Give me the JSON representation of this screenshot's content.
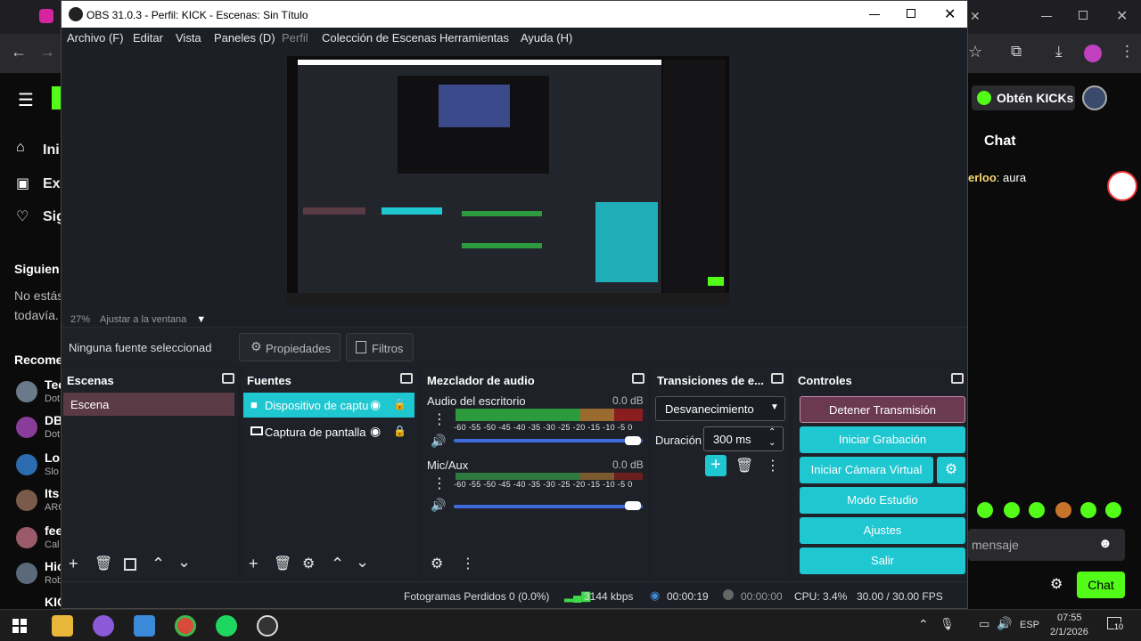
{
  "obs": {
    "title": "OBS 31.0.3 - Perfil: KICK - Escenas: Sin Título",
    "menu": [
      "Archivo (F)",
      "Editar",
      "Vista",
      "Paneles (D)",
      "Perfil",
      "Colección de Escenas",
      "Herramientas",
      "Ayuda (H)"
    ],
    "zoom": "27%",
    "fit_label": "Ajustar a la ventana",
    "no_source": "Ninguna fuente seleccionad",
    "properties": "Propiedades",
    "filters": "Filtros",
    "scenes": {
      "title": "Escenas",
      "items": [
        "Escena"
      ]
    },
    "sources": {
      "title": "Fuentes",
      "items": [
        "Dispositivo de captu",
        "Captura de pantalla"
      ]
    },
    "mixer": {
      "title": "Mezclador de audio",
      "channels": [
        {
          "name": "Audio del escritorio",
          "db": "0.0 dB"
        },
        {
          "name": "Mic/Aux",
          "db": "0.0 dB"
        }
      ],
      "scale": "-60 -55 -50 -45 -40 -35 -30 -25 -20 -15 -10 -5 0"
    },
    "transitions": {
      "title": "Transiciones de e...",
      "selected": "Desvanecimiento",
      "duration_label": "Duración",
      "duration": "300 ms"
    },
    "controls": {
      "title": "Controles",
      "stop_stream": "Detener Transmisión",
      "start_record": "Iniciar Grabación",
      "virtual_cam": "Iniciar Cámara Virtual",
      "studio_mode": "Modo Estudio",
      "settings": "Ajustes",
      "exit": "Salir"
    },
    "status": {
      "dropped": "Fotogramas Perdidos 0 (0.0%)",
      "bitrate": "3144 kbps",
      "stream_time": "00:00:19",
      "rec_time": "00:00:00",
      "cpu": "CPU: 3.4%",
      "fps": "30.00 / 30.00 FPS"
    }
  },
  "browser": {
    "sidebar": [
      "Ini",
      "Exp",
      "Sig"
    ],
    "following_title": "Siguien",
    "following_text": [
      "No estás",
      "todavía."
    ],
    "recommended_title": "Recome",
    "recommended": [
      {
        "name": "Tec",
        "sub": "Dot"
      },
      {
        "name": "DB",
        "sub": "Dot"
      },
      {
        "name": "Los",
        "sub": "Slo"
      },
      {
        "name": "Its",
        "sub": "ARC"
      },
      {
        "name": "fee",
        "sub": "Cal"
      },
      {
        "name": "Hic",
        "sub": "Rob"
      },
      {
        "name": "KIC",
        "sub": ""
      }
    ],
    "kicks_button": "Obtén KICKs",
    "chat_title": "Chat",
    "chat_message": {
      "user": "erloo",
      "text": "aura"
    },
    "message_placeholder": "mensaje",
    "chat_button": "Chat"
  },
  "taskbar": {
    "lang": "ESP",
    "time": "07:55",
    "date": "2/1/2026",
    "notifications": "10"
  }
}
